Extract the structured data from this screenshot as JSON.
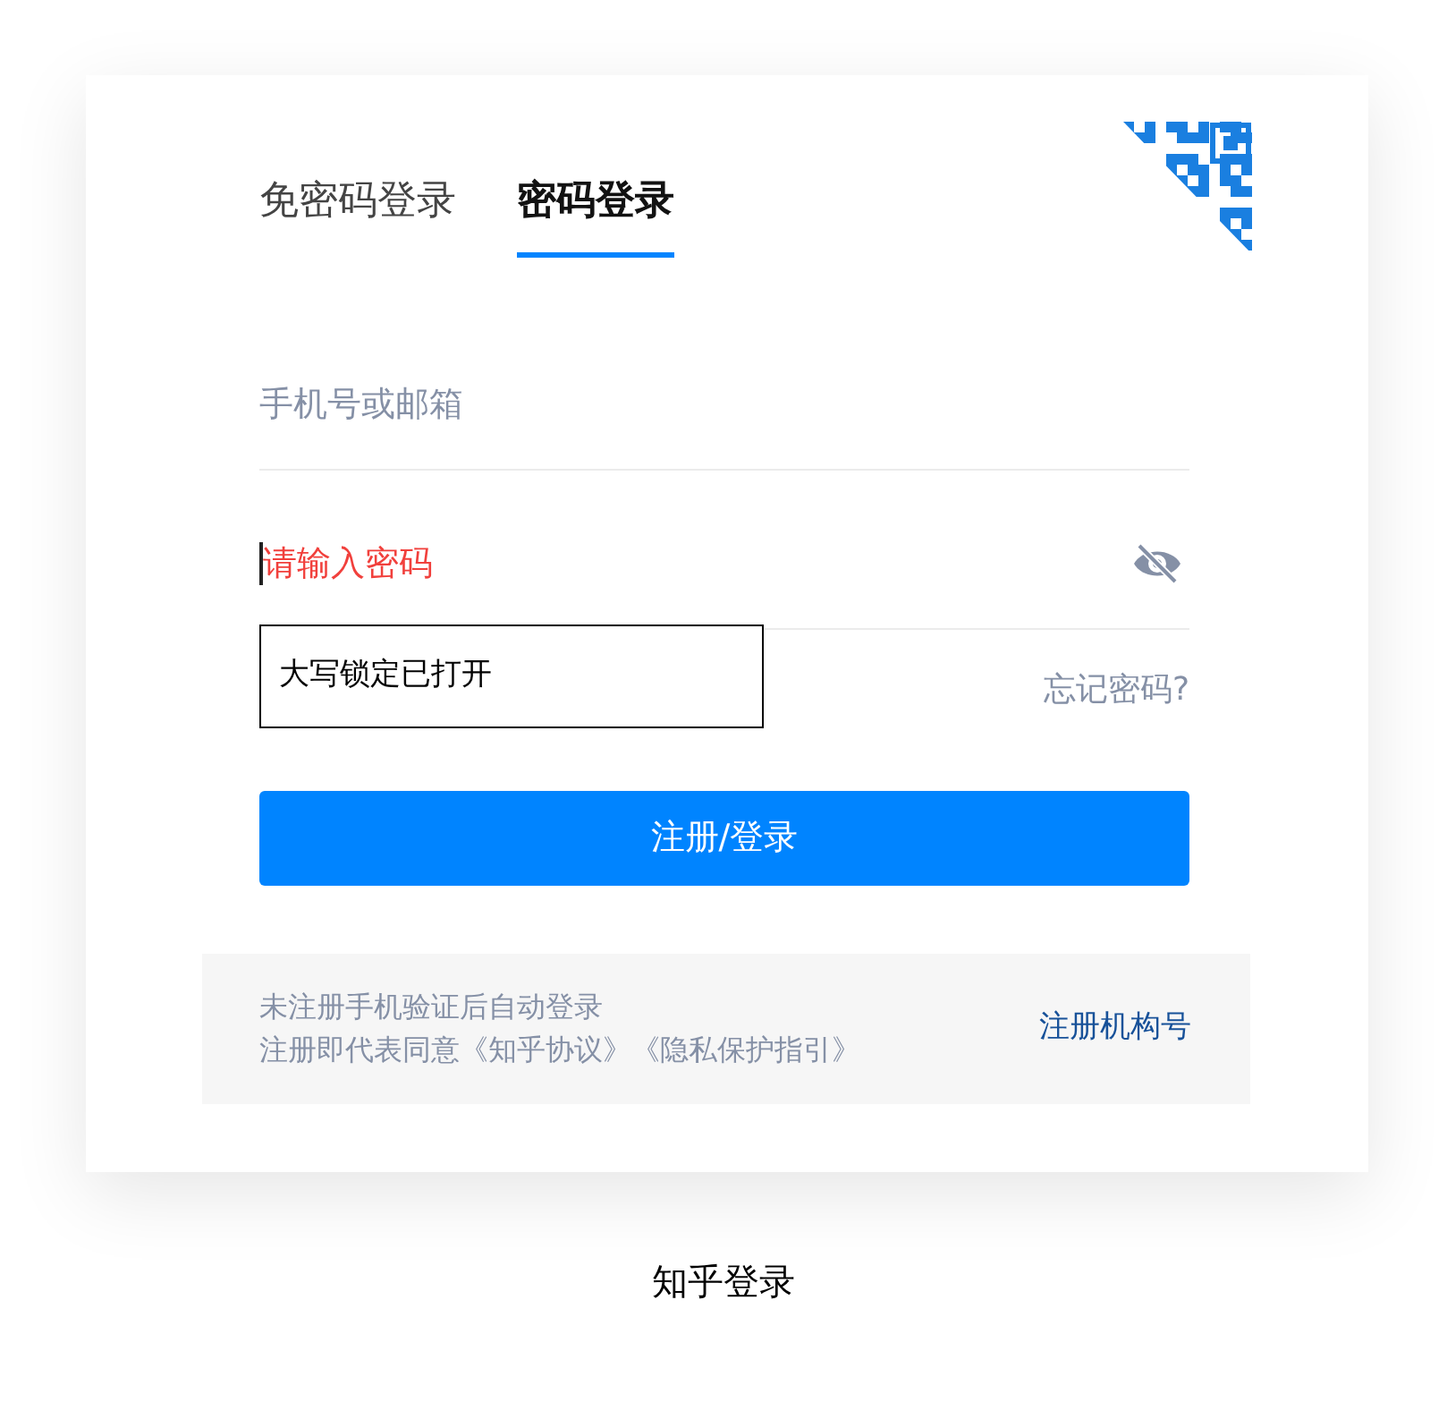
{
  "tabs": [
    {
      "label": "免密码登录",
      "selected": false
    },
    {
      "label": "密码登录",
      "selected": true
    }
  ],
  "fields": [
    {
      "kind": "text",
      "placeholder": "手机号或邮箱",
      "error": false,
      "focused": false
    },
    {
      "kind": "password",
      "placeholder": "请输入密码",
      "error": true,
      "focused": true,
      "revealed": false
    }
  ],
  "caps_lock_tooltip": "大写锁定已打开",
  "forgot_password": "忘记密码?",
  "submit_button": "注册/登录",
  "footer": {
    "lines": [
      "未注册手机验证后自动登录",
      "注册即代表同意《知乎协议》《隐私保护指引》"
    ],
    "link": "注册机构号"
  },
  "caption": "知乎登录"
}
